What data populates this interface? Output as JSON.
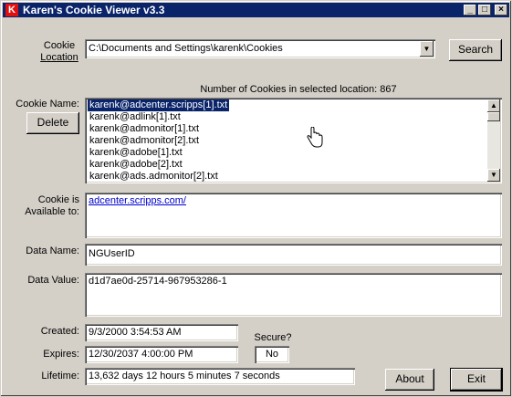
{
  "window": {
    "title": "Karen's Cookie Viewer v3.3",
    "icon_letter": "K"
  },
  "titlebar_buttons": {
    "minimize": "_",
    "maximize": "□",
    "close": "×"
  },
  "location": {
    "label_line1": "Cookie",
    "label_line2": "Location",
    "path": "C:\\Documents and Settings\\karenk\\Cookies",
    "dropdown_arrow": "▼",
    "search_label": "Search"
  },
  "count_text": "Number of Cookies in selected location: 867",
  "cookie_name_label": "Cookie Name:",
  "delete_label": "Delete",
  "cookies": [
    "karenk@adcenter.scripps[1].txt",
    "karenk@adlink[1].txt",
    "karenk@admonitor[1].txt",
    "karenk@admonitor[2].txt",
    "karenk@adobe[1].txt",
    "karenk@adobe[2].txt",
    "karenk@ads.admonitor[2].txt"
  ],
  "selected_index": 0,
  "scroll_up": "▲",
  "scroll_down": "▼",
  "available": {
    "label_line1": "Cookie is",
    "label_line2": "Available to:",
    "value": "adcenter.scripps.com/"
  },
  "data_name": {
    "label": "Data Name:",
    "value": "NGUserID"
  },
  "data_value": {
    "label": "Data Value:",
    "value": "d1d7ae0d-25714-967953286-1"
  },
  "created": {
    "label": "Created:",
    "value": "9/3/2000 3:54:53 AM"
  },
  "expires": {
    "label": "Expires:",
    "value": "12/30/2037 4:00:00 PM"
  },
  "secure": {
    "label": "Secure?",
    "value": "No"
  },
  "lifetime": {
    "label": "Lifetime:",
    "value": "13,632 days 12 hours 5 minutes 7 seconds"
  },
  "about_label": "About",
  "exit_label": "Exit"
}
